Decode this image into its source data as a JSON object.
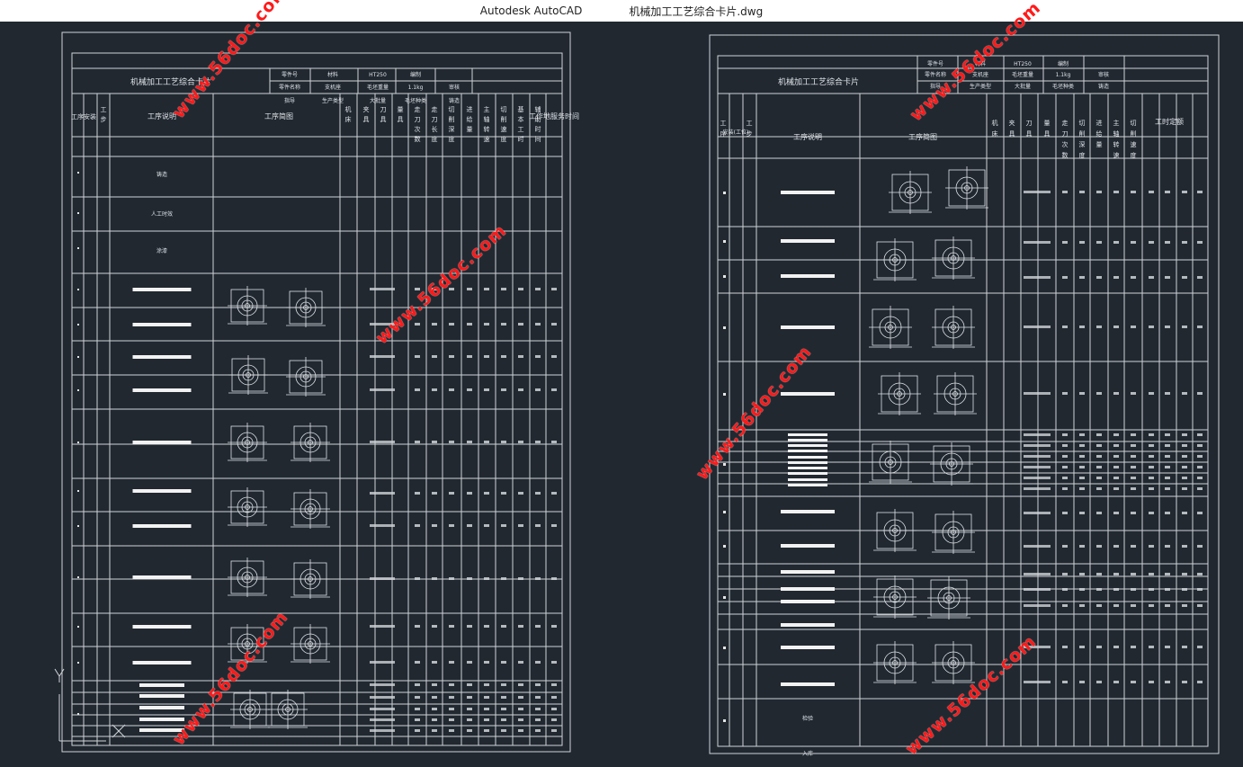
{
  "window": {
    "app_title": "Autodesk AutoCAD",
    "file_title": "机械加工工艺综合卡片.dwg"
  },
  "colors": {
    "canvas": "#212830",
    "line": "#cfd3d8",
    "watermark": "#ff1a1a"
  },
  "watermark_text": "www.56doc.com",
  "sheet_left": {
    "title": "机械加工工艺综合卡片",
    "header_labels": [
      "零件号",
      "材料",
      "HT250",
      "编制",
      "零件名称",
      "支机座",
      "毛坯重量",
      "1.1kg",
      "指导",
      "生产类型",
      "大批量",
      "毛坯种类",
      "铸造",
      "审核"
    ],
    "col_headers": [
      "工序",
      "安装",
      "工步",
      "工序说明",
      "工序简图",
      "机床",
      "夹具",
      "刀具",
      "量具",
      "走刀次数",
      "走刀长度",
      "切削深度",
      "进给量",
      "主轴转速",
      "切削速度",
      "基本工时",
      "辅助时间",
      "工作地服务时间"
    ],
    "process_notes": [
      "铸造",
      "人工时效",
      "涂漆"
    ]
  },
  "sheet_right": {
    "title": "机械加工工艺综合卡片",
    "header_labels": [
      "零件号",
      "材料",
      "HT250",
      "编制",
      "零件名称",
      "支机座",
      "毛坯重量",
      "1.1kg",
      "指导",
      "生产类型",
      "大批量",
      "毛坯种类",
      "铸造",
      "审核"
    ],
    "col_headers": [
      "工序",
      "安装(工位)",
      "工步",
      "工序说明",
      "工序简图",
      "机床",
      "夹具",
      "刀具",
      "量具",
      "走刀次数",
      "切削深度",
      "进给量",
      "主轴转速",
      "切削速度",
      "工时定额"
    ],
    "process_notes": [
      "检验",
      "入库"
    ]
  }
}
